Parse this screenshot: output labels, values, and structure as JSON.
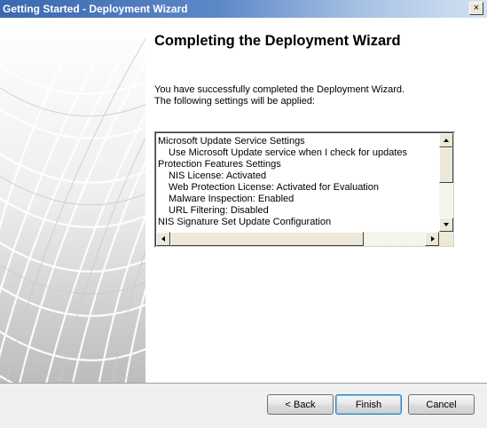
{
  "window": {
    "title": "Getting Started - Deployment Wizard",
    "close_glyph": "×"
  },
  "page": {
    "heading": "Completing the Deployment Wizard",
    "description_line1": "You have successfully completed the Deployment Wizard.",
    "description_line2": "The following settings will be applied:"
  },
  "settings": {
    "items": [
      {
        "text": "Microsoft Update Service Settings",
        "level": 0
      },
      {
        "text": "Use Microsoft Update service when I check for updates",
        "level": 1
      },
      {
        "text": "Protection Features Settings",
        "level": 0
      },
      {
        "text": "NIS License: Activated",
        "level": 1
      },
      {
        "text": "Web Protection License: Activated for Evaluation",
        "level": 1
      },
      {
        "text": "Malware Inspection: Enabled",
        "level": 1
      },
      {
        "text": "URL Filtering: Disabled",
        "level": 1
      },
      {
        "text": "NIS Signature Set Update Configuration",
        "level": 0
      }
    ]
  },
  "buttons": {
    "back": "< Back",
    "finish": "Finish",
    "cancel": "Cancel"
  },
  "colors": {
    "titlebar_start": "#3b68b0",
    "titlebar_end": "#d4e2f3",
    "default_button_border": "#3c7fb1"
  },
  "icons": {
    "close": "close-icon",
    "scroll_up": "arrow-up-icon",
    "scroll_down": "arrow-down-icon",
    "scroll_left": "arrow-left-icon",
    "scroll_right": "arrow-right-icon"
  }
}
